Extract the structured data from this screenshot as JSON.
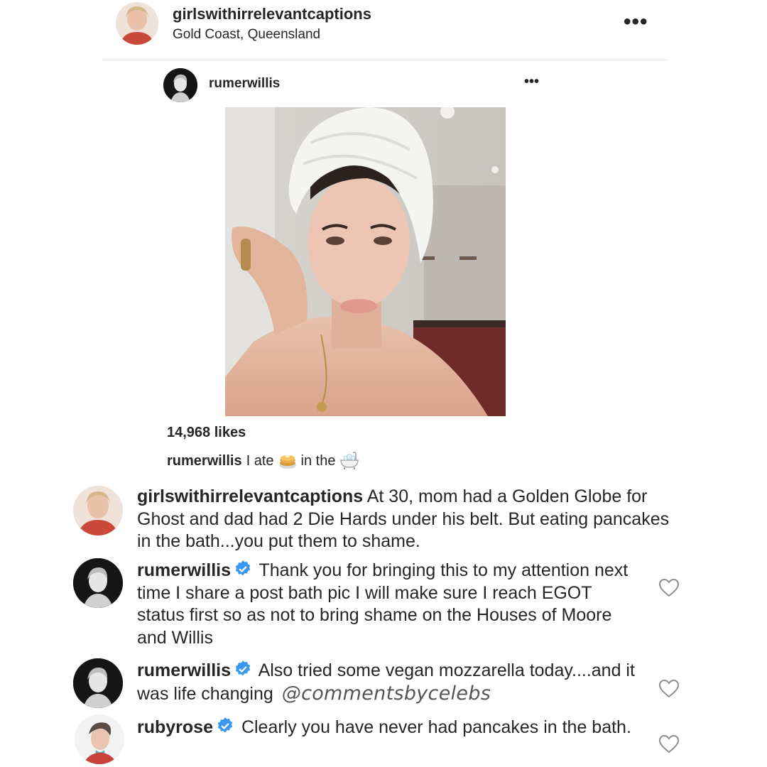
{
  "header": {
    "username": "girlswithirrelevantcaptions",
    "location": "Gold Coast, Queensland",
    "more_icon": "more-horizontal-icon"
  },
  "embedded_post": {
    "username": "rumerwillis",
    "more_icon": "more-horizontal-icon",
    "likes": "14,968 likes",
    "caption": {
      "username": "rumerwillis",
      "text_before": "I ate",
      "emoji1": "pancakes-emoji",
      "text_middle": "in the",
      "emoji2": "bathtub-emoji"
    }
  },
  "comments": [
    {
      "username": "girlswithirrelevantcaptions",
      "verified": false,
      "text": "At 30, mom had a Golden Globe for Ghost and dad had 2 Die Hards under his belt. But eating pancakes in the bath...you put them to shame."
    },
    {
      "username": "rumerwillis",
      "verified": true,
      "text": "Thank you for bringing this to my attention next time I share a post bath pic I will make sure I reach EGOT status first so as not to bring shame on the Houses of Moore and Willis"
    },
    {
      "username": "rumerwillis",
      "verified": true,
      "text": "Also tried some vegan mozzarella today....and it was life changing",
      "watermark": "@commentsbycelebs"
    },
    {
      "username": "rubyrose",
      "verified": true,
      "text": "Clearly you have never had pancakes in the bath."
    }
  ],
  "colors": {
    "verified_blue": "#3897f0",
    "text": "#262626",
    "heart_outline": "#8e8e8e"
  }
}
